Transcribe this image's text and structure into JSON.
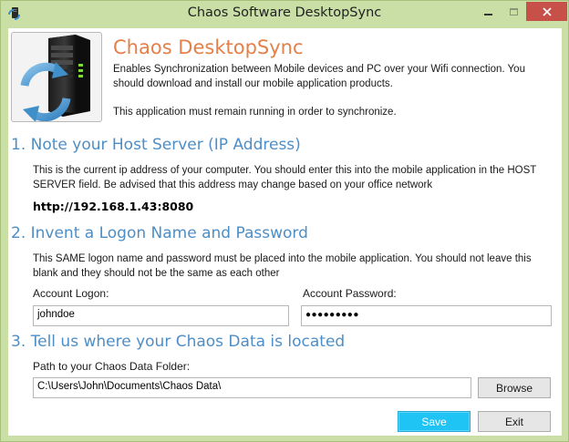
{
  "window": {
    "title": "Chaos Software DesktopSync",
    "close_symbol": "✕"
  },
  "header": {
    "title": "Chaos DesktopSync",
    "description": "Enables Synchronization between Mobile devices and PC over your Wifi connection.  You should download and install our mobile application products.",
    "note": "This application must remain running in order to synchronize."
  },
  "section1": {
    "title": "1.  Note your Host Server (IP Address)",
    "body": "This is the current ip address of your computer.  You should enter this into the mobile application in the HOST SERVER field.  Be advised that this address may change based on your office network",
    "ip": "http://192.168.1.43:8080"
  },
  "section2": {
    "title": "2.  Invent a Logon Name and Password",
    "body": "This SAME logon name and password must be placed into the mobile application.  You should not leave this blank and they should not be the same as each other",
    "logon_label": "Account Logon:",
    "logon_value": "johndoe",
    "password_label": "Account Password:",
    "password_value": "●●●●●●●●●"
  },
  "section3": {
    "title": "3.  Tell us where your Chaos Data is located",
    "path_label": "Path to your Chaos Data Folder:",
    "path_value": "C:\\Users\\John\\Documents\\Chaos Data\\",
    "browse_label": "Browse"
  },
  "buttons": {
    "save": "Save",
    "exit": "Exit"
  },
  "colors": {
    "frame": "#c9dfa6",
    "header_title": "#e4804a",
    "section_title": "#4d8ec6",
    "primary_button": "#20c4f4",
    "close_button": "#c7504a"
  }
}
